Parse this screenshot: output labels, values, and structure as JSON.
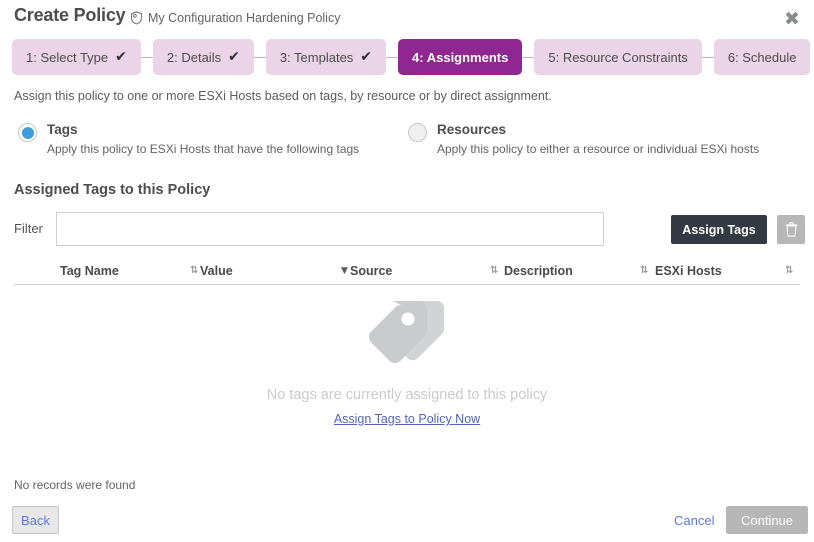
{
  "header": {
    "title": "Create Policy",
    "policy_name": "My Configuration Hardening Policy",
    "shield_icon": "shield-icon",
    "close_icon": "✖"
  },
  "steps": [
    {
      "label": "1: Select Type",
      "completed": true,
      "active": false
    },
    {
      "label": "2: Details",
      "completed": true,
      "active": false
    },
    {
      "label": "3: Templates",
      "completed": true,
      "active": false
    },
    {
      "label": "4: Assignments",
      "completed": false,
      "active": true
    },
    {
      "label": "5: Resource Constraints",
      "completed": false,
      "active": false
    },
    {
      "label": "6: Schedule",
      "completed": false,
      "active": false
    }
  ],
  "intro": "Assign this policy to one or more ESXi Hosts based on tags, by resource or by direct assignment.",
  "assignment_mode": {
    "tags": {
      "label": "Tags",
      "description": "Apply this policy to ESXi Hosts that have the following tags",
      "selected": true
    },
    "resources": {
      "label": "Resources",
      "description": "Apply this policy to either a resource or individual ESXi hosts",
      "selected": false
    }
  },
  "section": {
    "title": "Assigned Tags to this Policy"
  },
  "filter": {
    "label": "Filter",
    "value": "",
    "placeholder": ""
  },
  "toolbar": {
    "assign_tags_label": "Assign Tags",
    "delete_icon": "trash-icon"
  },
  "table": {
    "columns": [
      {
        "label": "Tag Name",
        "sort": "none"
      },
      {
        "label": "Value",
        "sort": "desc"
      },
      {
        "label": "Source",
        "sort": "none"
      },
      {
        "label": "Description",
        "sort": "none"
      },
      {
        "label": "ESXi Hosts",
        "sort": "none"
      }
    ],
    "rows": [],
    "sort_glyph_none": "⇅",
    "sort_glyph_desc": "▼"
  },
  "empty_state": {
    "icon": "tags-icon",
    "message": "No tags are currently assigned to this policy",
    "link_label": "Assign Tags to Policy Now"
  },
  "footer": {
    "records_status": "No records were found",
    "back_label": "Back",
    "cancel_label": "Cancel",
    "continue_label": "Continue"
  },
  "colors": {
    "step_active_bg": "#90268f",
    "step_bg": "#ebd3e8",
    "radio_selected": "#3c9dd8",
    "primary_button_bg": "#343a44",
    "link": "#5365b9",
    "disabled_button_bg": "#b7b7b7"
  }
}
